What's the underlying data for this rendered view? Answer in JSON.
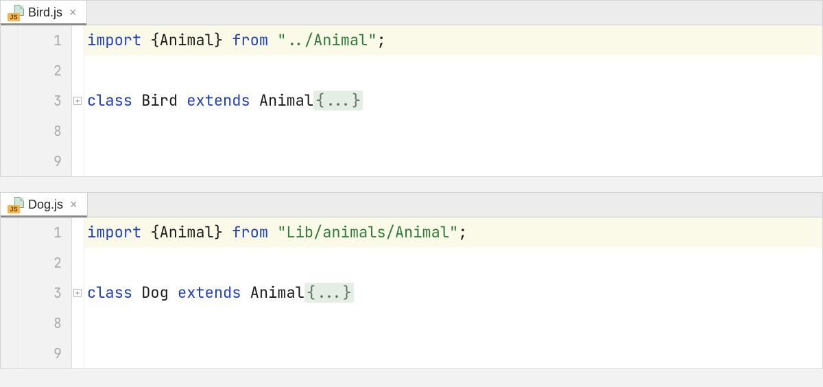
{
  "panes": [
    {
      "tab": {
        "filename": "Bird.js",
        "icon": "js-file-icon",
        "icon_badge": "JS"
      },
      "lines": [
        "1",
        "2",
        "3",
        "8",
        "9"
      ],
      "fold_at_index": 2,
      "code": {
        "l1_import": "import",
        "l1_lb": " {",
        "l1_sym": "Animal",
        "l1_rb": "} ",
        "l1_from": "from",
        "l1_sp": " ",
        "l1_str": "\"../Animal\"",
        "l1_semi": ";",
        "l3_class": "class",
        "l3_name": " Bird ",
        "l3_extends": "extends",
        "l3_parent": " Animal",
        "l3_fold": "{...}"
      }
    },
    {
      "tab": {
        "filename": "Dog.js",
        "icon": "js-file-icon",
        "icon_badge": "JS"
      },
      "lines": [
        "1",
        "2",
        "3",
        "8",
        "9"
      ],
      "fold_at_index": 2,
      "code": {
        "l1_import": "import",
        "l1_lb": " {",
        "l1_sym": "Animal",
        "l1_rb": "} ",
        "l1_from": "from",
        "l1_sp": " ",
        "l1_str": "\"Lib/animals/Animal\"",
        "l1_semi": ";",
        "l3_class": "class",
        "l3_name": " Dog ",
        "l3_extends": "extends",
        "l3_parent": " Animal",
        "l3_fold": "{...}"
      }
    }
  ]
}
